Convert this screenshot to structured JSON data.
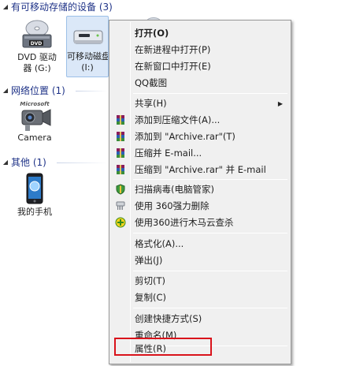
{
  "groups": [
    {
      "title": "有可移动存储的设备 (3)"
    },
    {
      "title": "网络位置 (1)"
    },
    {
      "title": "其他 (1)"
    }
  ],
  "devices": {
    "dvd": {
      "label1": "DVD 驱动",
      "label2": "器 (G:)",
      "badge": "DVD"
    },
    "removable": {
      "label1": "可移动磁盘",
      "label2": "(I:)"
    },
    "camera": {
      "label": "Camera",
      "brand": "Microsoft"
    },
    "phone": {
      "label": "我的手机"
    }
  },
  "menu": {
    "items": [
      {
        "label": "打开(O)",
        "bold": true
      },
      {
        "label": "在新进程中打开(P)"
      },
      {
        "label": "在新窗口中打开(E)"
      },
      {
        "label": "QQ截图"
      },
      {
        "label": "共享(H)",
        "submenu": true
      },
      {
        "label": "添加到压缩文件(A)...",
        "icon": "winrar-icon"
      },
      {
        "label": "添加到 \"Archive.rar\"(T)",
        "icon": "winrar-icon"
      },
      {
        "label": "压缩并 E-mail...",
        "icon": "winrar-icon"
      },
      {
        "label": "压缩到 \"Archive.rar\" 并 E-mail",
        "icon": "winrar-icon"
      },
      {
        "label": "扫描病毒(电脑管家)",
        "icon": "shield-icon"
      },
      {
        "label": "使用 360强力删除",
        "icon": "shredder-icon"
      },
      {
        "label": "使用360进行木马云查杀",
        "icon": "360-icon"
      },
      {
        "label": "格式化(A)..."
      },
      {
        "label": "弹出(J)"
      },
      {
        "label": "剪切(T)"
      },
      {
        "label": "复制(C)"
      },
      {
        "label": "创建快捷方式(S)"
      },
      {
        "label": "重命名(M)"
      },
      {
        "label": "属性(R)"
      }
    ]
  },
  "colors": {
    "accent": "#d9131b",
    "header": "#1e3287"
  }
}
